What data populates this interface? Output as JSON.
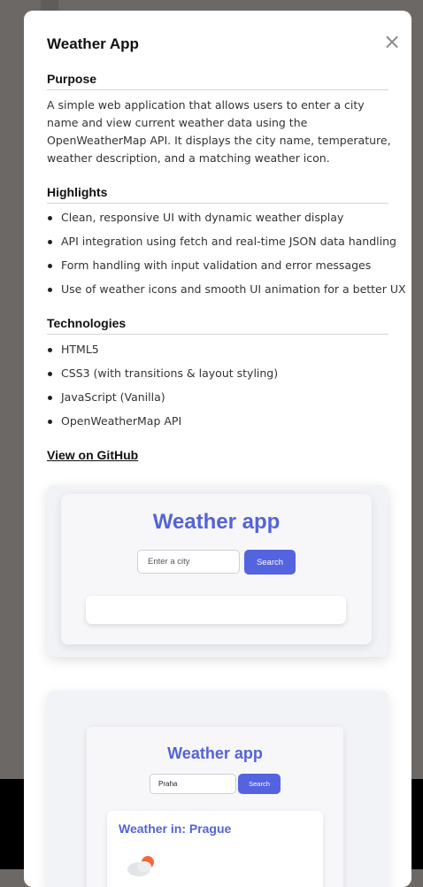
{
  "modal": {
    "title": "Weather App",
    "close_label": "×"
  },
  "purpose": {
    "heading": "Purpose",
    "text": "A simple web application that allows users to enter a city name and view current weather data using the OpenWeatherMap API. It displays the city name, temperature, weather description, and a matching weather icon."
  },
  "highlights": {
    "heading": "Highlights",
    "items": [
      "Clean, responsive UI with dynamic weather display",
      "API integration using fetch and real-time JSON data handling",
      "Form handling with input validation and error messages",
      "Use of weather icons and smooth UI animation for a better UX"
    ]
  },
  "technologies": {
    "heading": "Technologies",
    "items": [
      "HTML5",
      "CSS3 (with transitions & layout styling)",
      "JavaScript (Vanilla)",
      "OpenWeatherMap API"
    ]
  },
  "github": {
    "label": "View on GitHub"
  },
  "screenshot1": {
    "app_title": "Weather app",
    "input_placeholder": "Enter a city",
    "search_label": "Search"
  },
  "screenshot2": {
    "app_title": "Weather app",
    "input_value": "Praha",
    "search_label": "Search",
    "result_heading": "Weather in: Prague",
    "icon": "partly-cloudy-icon"
  },
  "colors": {
    "accent": "#5463d6",
    "button": "#5463e0",
    "overlay": "#6b6866"
  }
}
